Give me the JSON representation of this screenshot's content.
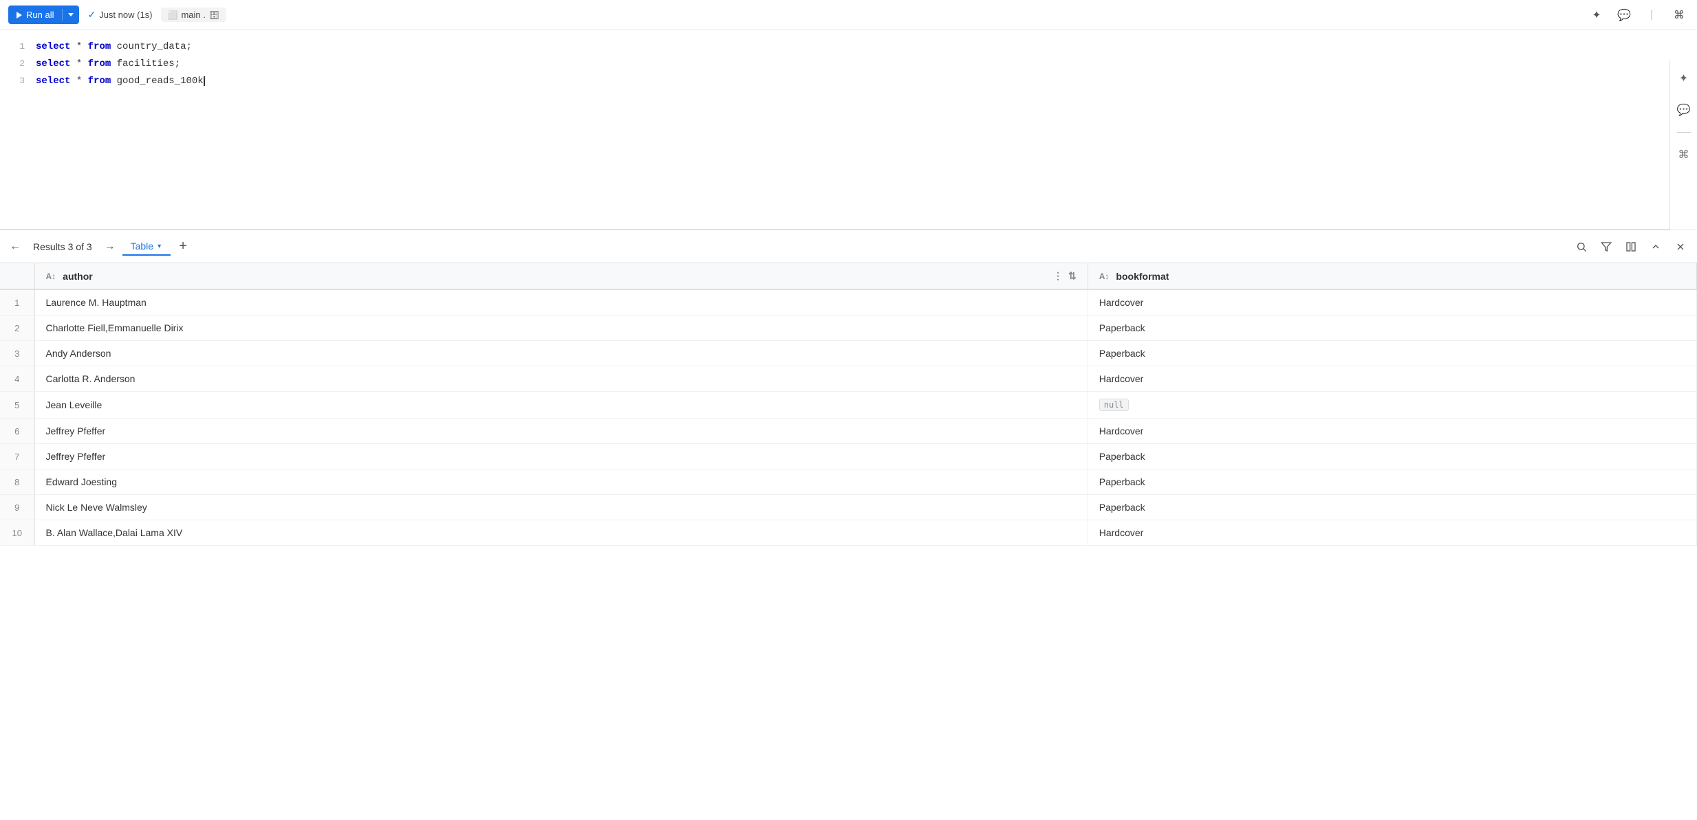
{
  "toolbar": {
    "run_all_label": "Run all",
    "status_label": "Just now (1s)",
    "tab_label": "main .",
    "spark_icon": "✦",
    "comment_icon": "💬",
    "shortcut_icon": "⌘"
  },
  "editor": {
    "lines": [
      {
        "num": "1",
        "code": "select * from country_data;"
      },
      {
        "num": "2",
        "code": "select * from facilities;"
      },
      {
        "num": "3",
        "code": "select * from good_reads_100k"
      }
    ]
  },
  "results": {
    "label": "Results 3 of 3",
    "tab_label": "Table",
    "columns": [
      {
        "id": "author",
        "label": "author",
        "type": "text"
      },
      {
        "id": "bookformat",
        "label": "bookformat",
        "type": "text"
      }
    ],
    "rows": [
      {
        "num": 1,
        "author": "Laurence M. Hauptman",
        "bookformat": "Hardcover"
      },
      {
        "num": 2,
        "author": "Charlotte Fiell,Emmanuelle Dirix",
        "bookformat": "Paperback"
      },
      {
        "num": 3,
        "author": "Andy Anderson",
        "bookformat": "Paperback"
      },
      {
        "num": 4,
        "author": "Carlotta R. Anderson",
        "bookformat": "Hardcover"
      },
      {
        "num": 5,
        "author": "Jean Leveille",
        "bookformat": null
      },
      {
        "num": 6,
        "author": "Jeffrey Pfeffer",
        "bookformat": "Hardcover"
      },
      {
        "num": 7,
        "author": "Jeffrey Pfeffer",
        "bookformat": "Paperback"
      },
      {
        "num": 8,
        "author": "Edward Joesting",
        "bookformat": "Paperback"
      },
      {
        "num": 9,
        "author": "Nick Le Neve Walmsley",
        "bookformat": "Paperback"
      },
      {
        "num": 10,
        "author": "B. Alan Wallace,Dalai Lama XIV",
        "bookformat": "Hardcover"
      }
    ]
  }
}
